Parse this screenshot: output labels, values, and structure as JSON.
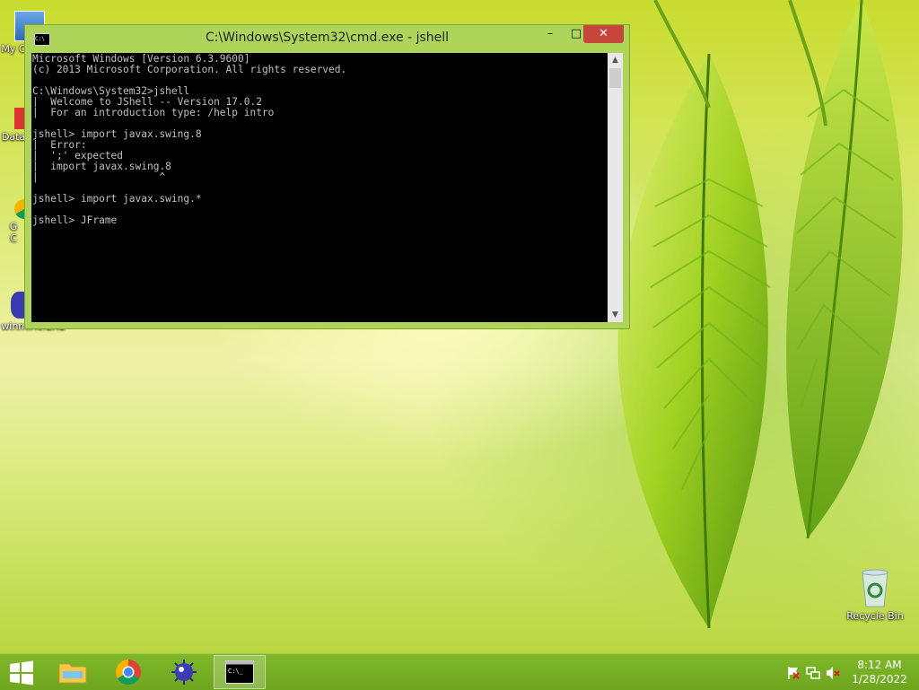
{
  "desktop": {
    "icons": [
      {
        "label": "My C",
        "icon": "computer-icon"
      },
      {
        "label": "Data",
        "icon": "shortcut-icon"
      },
      {
        "label": "G\nC",
        "icon": "chrome-shortcut-icon"
      },
      {
        "label": "winmine.EXE",
        "icon": "minesweeper-icon"
      },
      {
        "label": "Recycle Bin",
        "icon": "recycle-bin-icon"
      }
    ]
  },
  "window": {
    "title": "C:\\Windows\\System32\\cmd.exe - jshell",
    "controls": {
      "minimize": "–",
      "maximize": "□",
      "close": "✕"
    },
    "console_text": "Microsoft Windows [Version 6.3.9600]\n(c) 2013 Microsoft Corporation. All rights reserved.\n\nC:\\Windows\\System32>jshell\n|  Welcome to JShell -- Version 17.0.2\n|  For an introduction type: /help intro\n\njshell> import javax.swing.8\n|  Error:\n|  ';' expected\n|  import javax.swing.8\n|                    ^\n\njshell> import javax.swing.*\n\njshell> JFrame"
  },
  "taskbar": {
    "start_icon": "windows-start-icon",
    "pinned": [
      {
        "name": "file-explorer",
        "icon": "folder-icon"
      },
      {
        "name": "chrome",
        "icon": "chrome-icon"
      },
      {
        "name": "minesweeper",
        "icon": "mine-icon"
      },
      {
        "name": "cmd",
        "icon": "cmd-icon",
        "active": true
      }
    ],
    "tray_icons": [
      "action-center-flag-icon",
      "network-icon",
      "volume-muted-icon"
    ],
    "time": "8:12 AM",
    "date": "1/28/2022"
  },
  "colors": {
    "taskbar": "#6ea51e",
    "window_frame": "#aed45a",
    "console_bg": "#000000",
    "console_fg": "#c0c0c0",
    "close_button": "#c7463c"
  }
}
